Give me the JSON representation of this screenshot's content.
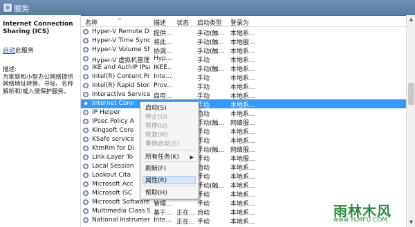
{
  "window": {
    "title": "服务"
  },
  "left_pane": {
    "service_title": "Internet Connection Sharing (ICS)",
    "link_text": "启动",
    "link_suffix": "此服务",
    "desc_label": "描述:",
    "desc_text": "为家庭和小型办公网络提供网络地址转换、寻址、名称解析和/或入侵保护服务。"
  },
  "columns": [
    "名称",
    "描述",
    "状态",
    "启动类型",
    "登录为"
  ],
  "rows": [
    [
      "Hyper-V Remote D...",
      "提供...",
      "",
      "手动(触...",
      "本地系..."
    ],
    [
      "Hyper-V Time Sync...",
      "将此...",
      "",
      "手动(触...",
      "本地服..."
    ],
    [
      "Hyper-V Volume Sh...",
      "协调...",
      "",
      "手动(触...",
      "本地系..."
    ],
    [
      "Hyper-V 虚拟机管理",
      "Hyp...",
      "",
      "手动",
      "本地系..."
    ],
    [
      "IKE and AuthIP IPse...",
      "IKEE...",
      "",
      "手动(触...",
      "本地系..."
    ],
    [
      "Intel(R) Content Pro...",
      "Inte...",
      "",
      "手动",
      "本地系..."
    ],
    [
      "Intel(R) Rapid Stora...",
      "Prov...",
      "",
      "手动",
      "本地系..."
    ],
    [
      "Interactive Services...",
      "启用...",
      "",
      "手动",
      "本地系..."
    ],
    [
      "Internet Conn",
      "",
      "",
      "手动",
      "本地系..."
    ],
    [
      "IP Helper",
      "",
      "",
      "自动",
      "本地系..."
    ],
    [
      "IPsec Policy A",
      "",
      "",
      "手动(触...",
      "网络服..."
    ],
    [
      "Kingsoft Core",
      "",
      "",
      "手动",
      "本地系..."
    ],
    [
      "KSafe service",
      "",
      "",
      "手动",
      "本地系..."
    ],
    [
      "KtmRm for Di",
      "",
      "",
      "手动(触...",
      "网络服..."
    ],
    [
      "Link-Layer To",
      "",
      "",
      "手动",
      "本地服..."
    ],
    [
      "Local Session",
      "",
      "",
      "自动",
      "本地系..."
    ],
    [
      "Lookout Cita",
      "",
      "",
      "手动",
      "本地系..."
    ],
    [
      "Microsoft Acc",
      "",
      "",
      "手动(触...",
      "本地系..."
    ],
    [
      "Microsoft iSC",
      "",
      "",
      "手动",
      "本地系..."
    ],
    [
      "Microsoft Software ...",
      "管理...",
      "",
      "手动",
      "本地系..."
    ],
    [
      "Multimedia Class Sc...",
      "基于...",
      "正在...",
      "自动",
      "本地系..."
    ],
    [
      "National Instrument...",
      "Inte...",
      "正在...",
      "手动",
      "本地系..."
    ]
  ],
  "selected_row": 8,
  "context_menu": {
    "items": [
      {
        "label": "启动(S)",
        "disabled": false
      },
      {
        "label": "停止(O)",
        "disabled": true
      },
      {
        "label": "暂停(U)",
        "disabled": true
      },
      {
        "label": "恢复(M)",
        "disabled": true
      },
      {
        "label": "重新启动(E)",
        "disabled": true
      },
      {
        "label": "所有任务(K)",
        "disabled": false,
        "submenu": true
      },
      {
        "label": "刷新(F)",
        "disabled": false
      },
      {
        "label": "属性(R)",
        "disabled": false,
        "highlighted": true
      },
      {
        "label": "帮助(H)",
        "disabled": false
      }
    ]
  },
  "watermark": {
    "brand": "雨林木风",
    "url": "www.YLMFU.COM"
  }
}
